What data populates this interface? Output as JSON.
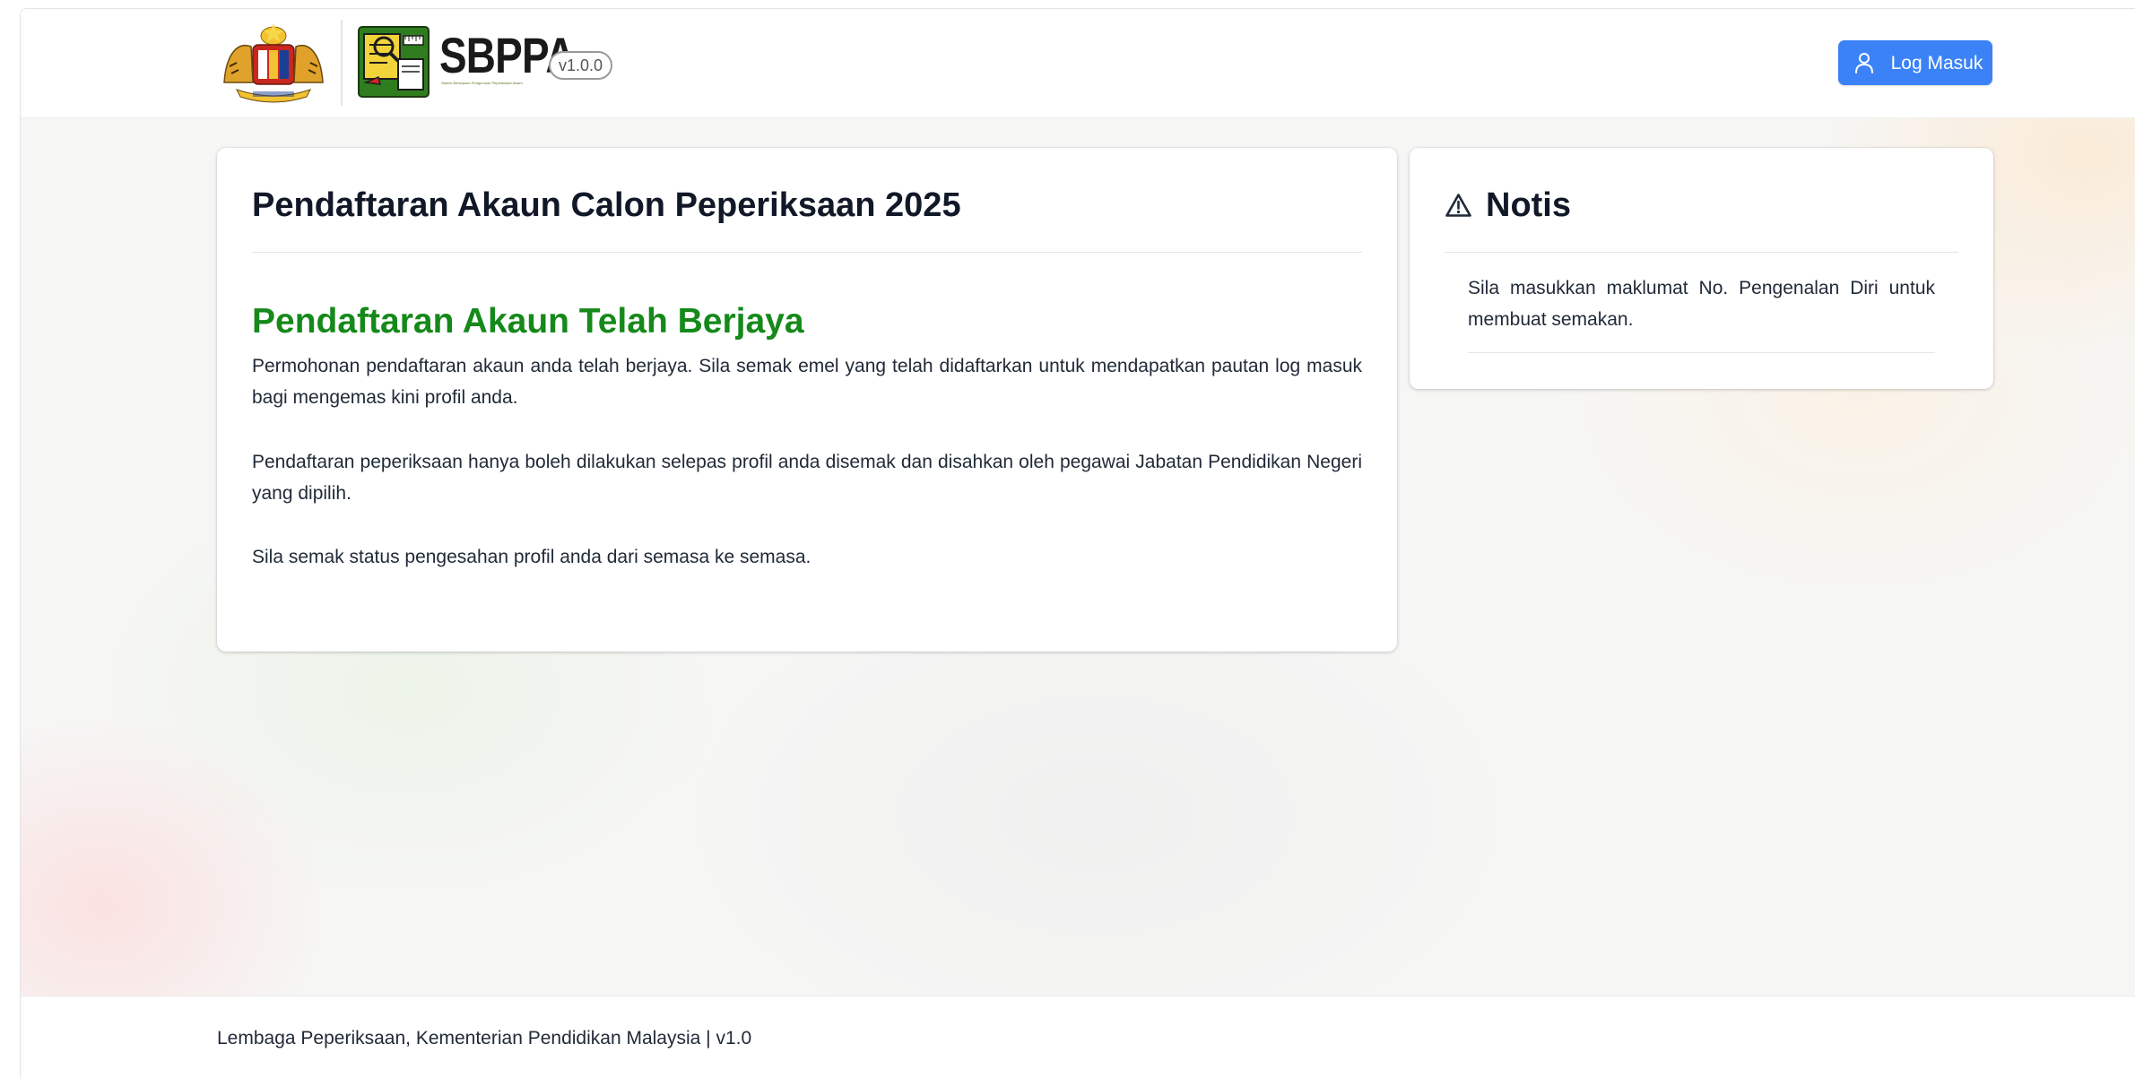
{
  "header": {
    "brand_name": "SBPPA",
    "brand_tagline": "Sistem Bersepadu Pengurusan Peperiksaan Awam",
    "version_badge": "v1.0.0",
    "login_label": "Log Masuk"
  },
  "main_card": {
    "title": "Pendaftaran Akaun Calon Peperiksaan 2025",
    "success_title": "Pendaftaran Akaun Telah Berjaya",
    "paragraphs": [
      "Permohonan pendaftaran akaun anda telah berjaya. Sila semak emel yang telah didaftarkan untuk mendapatkan pautan log masuk bagi mengemas kini profil anda.",
      "Pendaftaran peperiksaan hanya boleh dilakukan selepas profil anda disemak dan disahkan oleh pegawai Jabatan Pendidikan Negeri yang dipilih.",
      "Sila semak status pengesahan profil anda dari semasa ke semasa."
    ]
  },
  "notice_card": {
    "title": "Notis",
    "text": "Sila masukkan maklumat No. Pengenalan Diri untuk membuat semakan."
  },
  "footer": {
    "text": "Lembaga Peperiksaan, Kementerian Pendidikan Malaysia | v1.0"
  },
  "icons": {
    "login": "user-icon",
    "notice": "warning-triangle-icon"
  },
  "colors": {
    "primary": "#3b82f6",
    "success": "#15891a",
    "text": "#1f2937"
  }
}
